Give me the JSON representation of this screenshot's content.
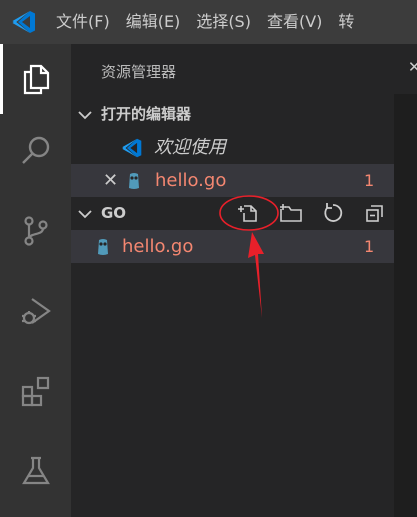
{
  "menu": {
    "items": [
      "文件(F)",
      "编辑(E)",
      "选择(S)",
      "查看(V)",
      "转"
    ]
  },
  "activity_bar": {
    "icons": [
      "files-icon",
      "search-icon",
      "source-control-icon",
      "run-debug-icon",
      "extensions-icon",
      "testing-icon"
    ]
  },
  "explorer": {
    "title": "资源管理器",
    "open_editors": {
      "header": "打开的编辑器",
      "items": [
        {
          "label": "欢迎使用",
          "icon": "vscode-logo-icon"
        },
        {
          "label": "hello.go",
          "icon": "go-gopher-icon",
          "count": "1"
        }
      ]
    },
    "folder": {
      "header": "GO",
      "actions": [
        "new-file-icon",
        "new-folder-icon",
        "refresh-icon",
        "collapse-all-icon"
      ],
      "items": [
        {
          "label": "hello.go",
          "icon": "go-gopher-icon",
          "count": "1"
        }
      ]
    }
  },
  "colors": {
    "accent": "#0098ff",
    "error_text": "#f48771",
    "annotation": "#e8202a"
  }
}
